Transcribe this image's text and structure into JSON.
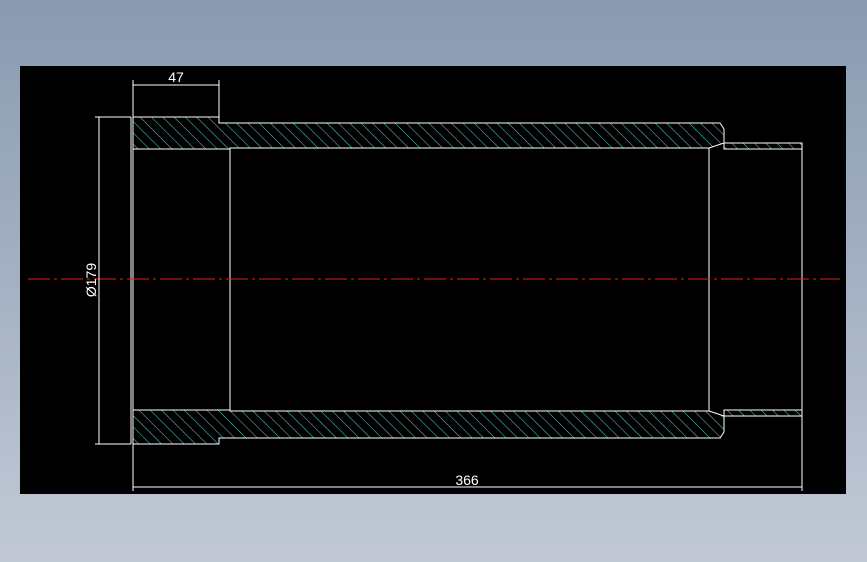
{
  "drawing": {
    "dimensions": {
      "top_width": "47",
      "diameter": "Ø179",
      "overall_length": "366"
    },
    "colors": {
      "background": "#000000",
      "outline": "#ffffff",
      "hatch": "#5fd3d3",
      "centerline": "#e0201e",
      "dimension": "#ffffff"
    }
  }
}
